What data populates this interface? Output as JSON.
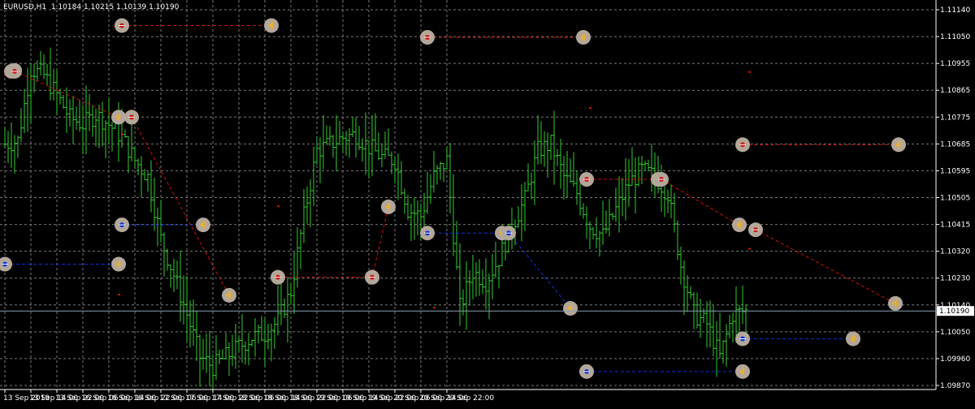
{
  "chart": {
    "symbol_tf": "EURUSD,H1",
    "ohlc_text": "1.10184 1.10215 1.10139 1.10190",
    "current_price_label": "1.10190"
  },
  "colors": {
    "background": "#000000",
    "grid": "#7a7a7a",
    "bar": "#33cc33",
    "sell_line": "#d01010",
    "buy_line": "#1030e0",
    "marker_ring": "#b3a79a",
    "current_price_line": "#8aa0b4",
    "axis_text": "#ffffff"
  },
  "chart_data": {
    "type": "bar",
    "title": "EURUSD,H1",
    "ylim": [
      1.0995,
      1.1114
    ],
    "grid": true,
    "y_ticks": [
      "1.11140",
      "1.11050",
      "1.10955",
      "1.10865",
      "1.10775",
      "1.10685",
      "1.10595",
      "1.10505",
      "1.10415",
      "1.10320",
      "1.10230",
      "1.10140",
      "1.10050",
      "1.09960",
      "1.09870"
    ],
    "x_ticks": [
      "13 Sep 2019",
      "13 Sep 14:00",
      "13 Sep 22:00",
      "16 Sep 06:00",
      "16 Sep 14:00",
      "16 Sep 22:00",
      "17 Sep 06:00",
      "17 Sep 14:00",
      "17 Sep 22:00",
      "18 Sep 06:00",
      "18 Sep 14:00",
      "18 Sep 22:00",
      "19 Sep 06:00",
      "19 Sep 14:00",
      "19 Sep 22:00",
      "20 Sep 06:00",
      "20 Sep 14:00",
      "20 Sep 22:00"
    ],
    "bars_per_tick": 8,
    "current_price": 1.1019,
    "close_keypoints": [
      [
        0,
        1.107
      ],
      [
        4,
        1.1071
      ],
      [
        8,
        1.1093
      ],
      [
        12,
        1.1091
      ],
      [
        16,
        1.1085
      ],
      [
        20,
        1.1078
      ],
      [
        24,
        1.1076
      ],
      [
        28,
        1.1079
      ],
      [
        32,
        1.1076
      ],
      [
        36,
        1.1072
      ],
      [
        40,
        1.1065
      ],
      [
        44,
        1.106
      ],
      [
        48,
        1.1041
      ],
      [
        52,
        1.103
      ],
      [
        56,
        1.1018
      ],
      [
        60,
        1.1005
      ],
      [
        64,
        1.1002
      ],
      [
        68,
        1.1005
      ],
      [
        72,
        1.1008
      ],
      [
        76,
        1.1011
      ],
      [
        80,
        1.1012
      ],
      [
        84,
        1.1016
      ],
      [
        88,
        1.1025
      ],
      [
        92,
        1.1048
      ],
      [
        96,
        1.1068
      ],
      [
        100,
        1.107
      ],
      [
        104,
        1.1072
      ],
      [
        108,
        1.1073
      ],
      [
        112,
        1.1069
      ],
      [
        116,
        1.1066
      ],
      [
        120,
        1.1065
      ],
      [
        124,
        1.105
      ],
      [
        128,
        1.1048
      ],
      [
        132,
        1.106
      ],
      [
        136,
        1.1065
      ],
      [
        140,
        1.102
      ],
      [
        144,
        1.1031
      ],
      [
        148,
        1.1028
      ],
      [
        152,
        1.1035
      ],
      [
        156,
        1.1045
      ],
      [
        160,
        1.1053
      ],
      [
        164,
        1.1068
      ],
      [
        168,
        1.107
      ],
      [
        172,
        1.106
      ],
      [
        176,
        1.1055
      ],
      [
        180,
        1.1045
      ],
      [
        184,
        1.1042
      ],
      [
        188,
        1.105
      ],
      [
        192,
        1.1058
      ],
      [
        196,
        1.1062
      ],
      [
        200,
        1.106
      ],
      [
        204,
        1.1055
      ],
      [
        208,
        1.1033
      ],
      [
        212,
        1.1018
      ],
      [
        216,
        1.1015
      ],
      [
        220,
        1.1005
      ],
      [
        224,
        1.1018
      ],
      [
        228,
        1.1019
      ]
    ],
    "trades": [
      {
        "type": "sell",
        "open_bar": 2,
        "open_price": 1.10922,
        "close_bar": 3,
        "close_price": 1.10925
      },
      {
        "type": "sell",
        "open_bar": 3,
        "open_price": 1.10922,
        "close_bar": 35,
        "close_price": 1.10782
      },
      {
        "type": "sell",
        "open_bar": 36,
        "open_price": 1.11062,
        "close_bar": 82,
        "close_price": 1.11062
      },
      {
        "type": "buy",
        "open_bar": 36,
        "open_price": 1.10453,
        "close_bar": 61,
        "close_price": 1.10453
      },
      {
        "type": "buy",
        "open_bar": 0,
        "open_price": 1.10333,
        "close_bar": 35,
        "close_price": 1.10333
      },
      {
        "type": "sell",
        "open_bar": 39,
        "open_price": 1.10782,
        "close_bar": 69,
        "close_price": 1.10238
      },
      {
        "type": "sell",
        "open_bar": 84,
        "open_price": 1.10293,
        "close_bar": 113,
        "close_price": 1.10293
      },
      {
        "type": "sell",
        "open_bar": 113,
        "open_price": 1.10293,
        "close_bar": 118,
        "close_price": 1.10508
      },
      {
        "type": "sell",
        "open_bar": 130,
        "open_price": 1.11026,
        "close_bar": 178,
        "close_price": 1.11026
      },
      {
        "type": "buy",
        "open_bar": 130,
        "open_price": 1.10428,
        "close_bar": 153,
        "close_price": 1.10428
      },
      {
        "type": "buy",
        "open_bar": 155,
        "open_price": 1.10428,
        "close_bar": 174,
        "close_price": 1.10198
      },
      {
        "type": "sell",
        "open_bar": 179,
        "open_price": 1.10592,
        "close_bar": 201,
        "close_price": 1.10592
      },
      {
        "type": "sell",
        "open_bar": 202,
        "open_price": 1.10592,
        "close_bar": 226,
        "close_price": 1.10453
      },
      {
        "type": "buy",
        "open_bar": 179,
        "open_price": 1.10005,
        "close_bar": 227,
        "close_price": 1.10005
      },
      {
        "type": "sell",
        "open_bar": 227,
        "open_price": 1.10698,
        "close_bar": 275,
        "close_price": 1.10698
      },
      {
        "type": "buy",
        "open_bar": 227,
        "open_price": 1.10105,
        "close_bar": 261,
        "close_price": 1.10105
      },
      {
        "type": "sell",
        "open_bar": 231,
        "open_price": 1.10438,
        "close_bar": 274,
        "close_price": 1.10213
      }
    ],
    "dot_markers": [
      {
        "bar": 35,
        "price": 1.1024
      },
      {
        "bar": 84,
        "price": 1.1051
      },
      {
        "bar": 132,
        "price": 1.102
      },
      {
        "bar": 180,
        "price": 1.1081
      },
      {
        "bar": 229,
        "price": 1.1092
      },
      {
        "bar": 229,
        "price": 1.0988
      },
      {
        "bar": 229,
        "price": 1.1038
      },
      {
        "bar": 36,
        "price": 1.1073
      }
    ]
  }
}
